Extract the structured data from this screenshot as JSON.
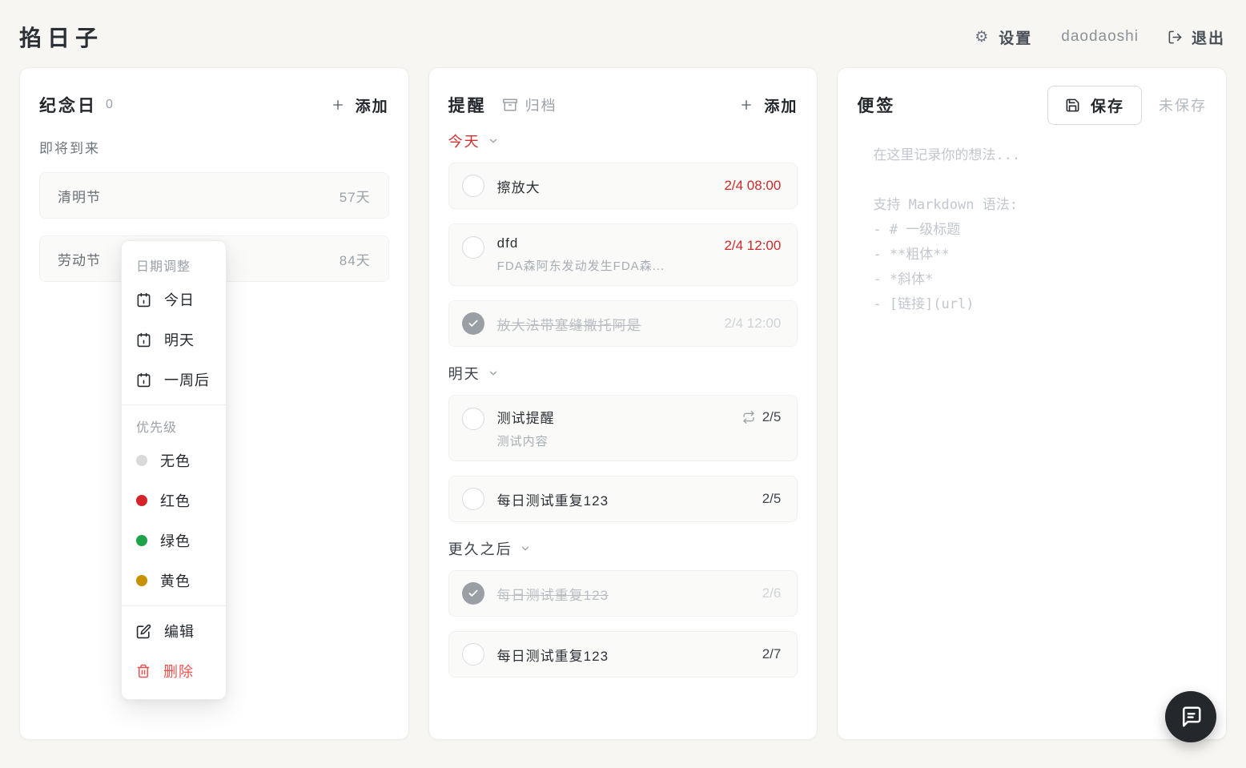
{
  "app": {
    "title": "掐日子"
  },
  "header": {
    "settings_label": "设置",
    "username": "daodaoshi",
    "logout_label": "退出"
  },
  "icons": {
    "gear": "⚙"
  },
  "anniversary": {
    "title": "纪念日",
    "count": "0",
    "add_label": "添加",
    "section_label": "即将到来",
    "items": [
      {
        "name": "清明节",
        "days": "57天"
      },
      {
        "name": "劳动节",
        "days": "84天"
      }
    ]
  },
  "context_menu": {
    "date_section_label": "日期调整",
    "date_options": [
      {
        "label": "今日"
      },
      {
        "label": "明天"
      },
      {
        "label": "一周后"
      }
    ],
    "priority_section_label": "优先级",
    "priority_options": [
      {
        "label": "无色",
        "color": "#d9d9d9"
      },
      {
        "label": "红色",
        "color": "#d5232b"
      },
      {
        "label": "绿色",
        "color": "#1ea24b"
      },
      {
        "label": "黄色",
        "color": "#c79100"
      }
    ],
    "edit_label": "编辑",
    "delete_label": "删除"
  },
  "reminders": {
    "title": "提醒",
    "archive_label": "归档",
    "add_label": "添加",
    "groups": [
      {
        "label": "今天",
        "items": [
          {
            "title": "擦放大",
            "time": "2/4 08:00"
          },
          {
            "title": "dfd",
            "subtitle": "FDA森阿东发动发生FDA森...",
            "time": "2/4 12:00"
          },
          {
            "title": "放大法带塞缝撒托阿是",
            "time": "2/4 12:00"
          }
        ]
      },
      {
        "label": "明天",
        "items": [
          {
            "title": "测试提醒",
            "subtitle": "测试内容",
            "time": "2/5"
          },
          {
            "title": "每日测试重复123",
            "time": "2/5"
          }
        ]
      },
      {
        "label": "更久之后",
        "items": [
          {
            "title": "每日测试重复123",
            "time": "2/6"
          },
          {
            "title": "每日测试重复123",
            "time": "2/7"
          }
        ]
      }
    ]
  },
  "notes": {
    "title": "便签",
    "save_label": "保存",
    "status": "未保存",
    "placeholder": "在这里记录你的想法...\n\n支持 Markdown 语法:\n- # 一级标题\n- **粗体**\n- *斜体*\n- [链接](url)"
  },
  "colors": {
    "accent_red": "#cf2a2a",
    "delete_red": "#ef5350",
    "done_gray": "#999fa5",
    "fab_bg": "#24272b"
  }
}
